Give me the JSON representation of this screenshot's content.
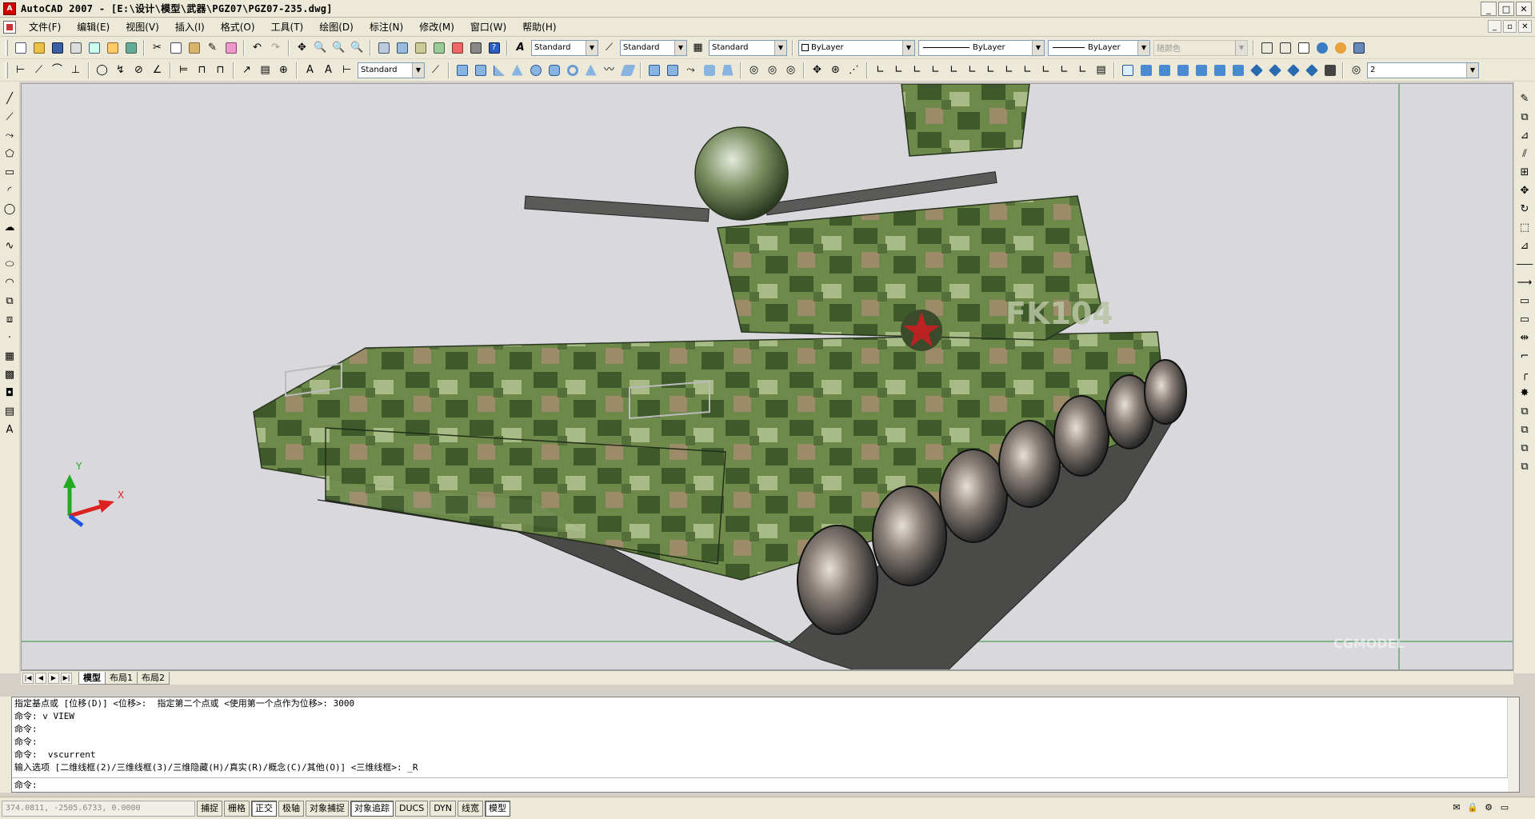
{
  "window": {
    "title": "AutoCAD 2007 - [E:\\设计\\模型\\武器\\PGZ07\\PGZ07-235.dwg]",
    "app_icon_text": "A",
    "controls": [
      "_",
      "□",
      "✕"
    ],
    "doc_controls": [
      "_",
      "▫",
      "✕"
    ]
  },
  "menu": {
    "items": [
      "文件(F)",
      "编辑(E)",
      "视图(V)",
      "插入(I)",
      "格式(O)",
      "工具(T)",
      "绘图(D)",
      "标注(N)",
      "修改(M)",
      "窗口(W)",
      "帮助(H)"
    ]
  },
  "toolbar1": {
    "text_style": "Standard",
    "dim_style": "Standard",
    "table_style": "Standard",
    "layer": "ByLayer",
    "linetype": "ByLayer",
    "lineweight": "ByLayer",
    "plot_style": "随颜色"
  },
  "toolbar2": {
    "ml_style": "Standard",
    "view_value": "2"
  },
  "drawing": {
    "ucs_y": "Y",
    "ucs_x": "X",
    "vehicle_marking": "FK104",
    "watermark": "CGMODEL"
  },
  "layout_tabs": [
    "模型",
    "布局1",
    "布局2"
  ],
  "command": {
    "history": [
      "指定基点或 [位移(D)] <位移>:  指定第二个点或 <使用第一个点作为位移>: 3000",
      "命令: v VIEW",
      "命令:",
      "命令:",
      "命令:  vscurrent",
      "输入选项 [二维线框(2)/三维线框(3)/三维隐藏(H)/真实(R)/概念(C)/其他(O)] <三维线框>: _R"
    ],
    "prompt": "命令:"
  },
  "status": {
    "coords": "374.0811,  -2505.6733, 0.0000",
    "toggles": [
      {
        "label": "捕捉",
        "on": false
      },
      {
        "label": "栅格",
        "on": false
      },
      {
        "label": "正交",
        "on": true
      },
      {
        "label": "极轴",
        "on": false
      },
      {
        "label": "对象捕捉",
        "on": false
      },
      {
        "label": "对象追踪",
        "on": true
      },
      {
        "label": "DUCS",
        "on": false
      },
      {
        "label": "DYN",
        "on": false
      },
      {
        "label": "线宽",
        "on": false
      },
      {
        "label": "模型",
        "on": true
      }
    ]
  },
  "colors": {
    "ucs_y": "#22aa22",
    "ucs_x": "#dd2222",
    "ucs_z": "#2255dd",
    "camo_dark": "#3f5a2a",
    "camo_mid": "#6d8a4a",
    "camo_light": "#a8ba86",
    "camo_tan": "#9c8a68"
  }
}
